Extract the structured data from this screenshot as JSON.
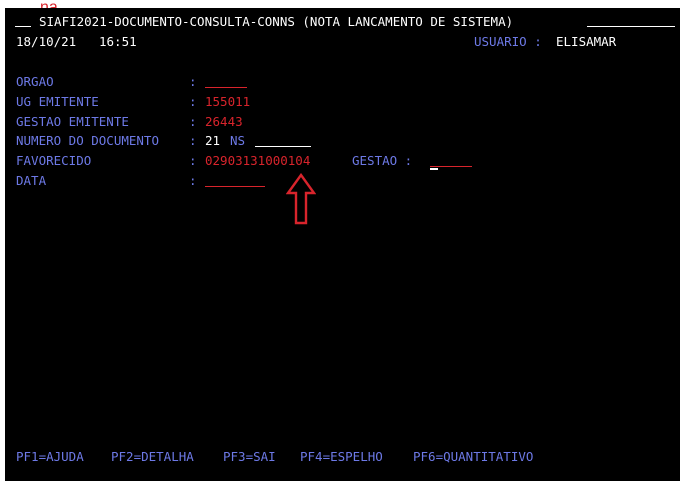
{
  "header": {
    "title": "SIAFI2021-DOCUMENTO-CONSULTA-CONNS (NOTA LANCAMENTO DE SISTEMA)",
    "date": "18/10/21",
    "time": "16:51",
    "user_label": "USUARIO :",
    "user_name": "ELISAMAR"
  },
  "form": {
    "orgao_label": "ORGAO",
    "orgao_value": "",
    "ug_emitente_label": "UG EMITENTE",
    "ug_emitente_value": "155011",
    "gestao_emitente_label": "GESTAO EMITENTE",
    "gestao_emitente_value": "26443",
    "numero_documento_label": "NUMERO DO DOCUMENTO",
    "numero_documento_value": "21",
    "numero_documento_type": "NS",
    "favorecido_label": "FAVORECIDO",
    "favorecido_value": "02903131000104",
    "gestao_label": "GESTAO :",
    "gestao_value": "",
    "data_label": "DATA",
    "data_value": ""
  },
  "function_keys": [
    "PF1=AJUDA",
    "PF2=DETALHA",
    "PF3=SAI",
    "PF4=ESPELHO",
    "PF6=QUANTITATIVO"
  ],
  "colors": {
    "background": "#000000",
    "label": "#6d79e6",
    "value": "#d8242c",
    "highlight": "#ffffff",
    "arrow": "#d8242c"
  },
  "icons": {
    "annotation": "up-arrow-icon"
  }
}
